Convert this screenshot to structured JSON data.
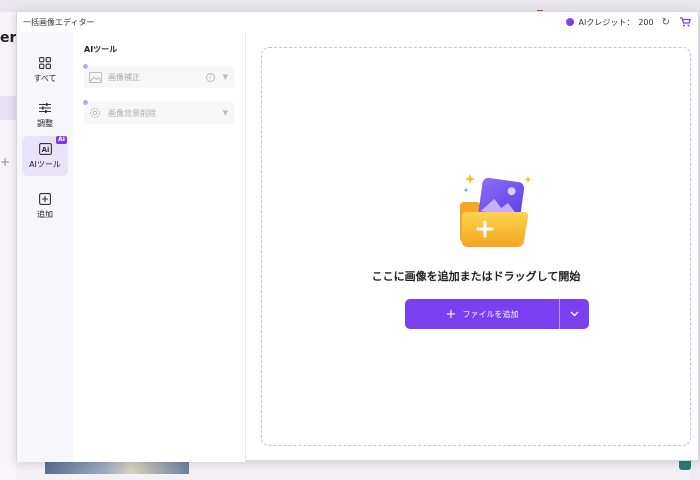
{
  "background": {
    "partial_title": "er"
  },
  "window": {
    "title": "一括画像エディター",
    "credits_label": "AIクレジット：",
    "credits_value": "200",
    "icons": {
      "credit": "credit-coin-icon",
      "refresh": "refresh-icon",
      "cart": "cart-icon"
    },
    "accent": "#7b3ff2"
  },
  "rail": {
    "items": [
      {
        "label": "すべて",
        "icon": "grid-icon"
      },
      {
        "label": "調整",
        "icon": "sliders-icon"
      },
      {
        "label": "AIツール",
        "icon": "ai-tool-icon",
        "badge": "AI",
        "active": true
      },
      {
        "label": "追加",
        "icon": "add-square-icon"
      }
    ]
  },
  "panel": {
    "title": "AIツール",
    "tools": [
      {
        "label": "画像補正",
        "icon": "enhance-image-icon",
        "has_info": true
      },
      {
        "label": "画像背景削除",
        "icon": "remove-background-icon",
        "has_info": false
      }
    ]
  },
  "dropzone": {
    "prompt": "ここに画像を追加またはドラッグして開始",
    "add_button_label": "ファイルを追加",
    "illustration": "folder-image-add-illustration"
  }
}
